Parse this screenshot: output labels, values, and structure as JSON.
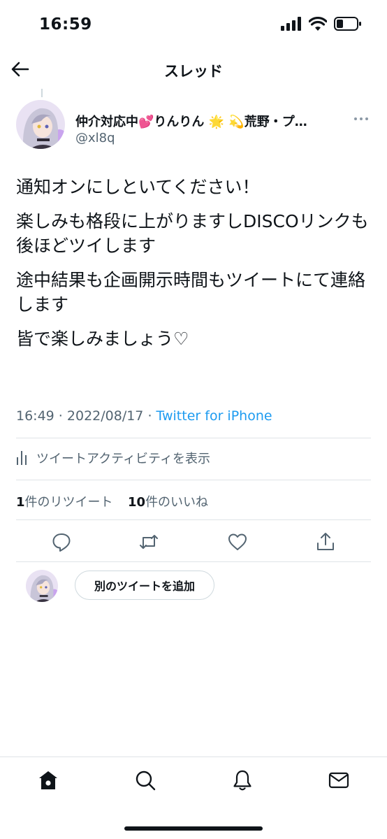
{
  "status_bar": {
    "time": "16:59"
  },
  "header": {
    "title": "スレッド"
  },
  "author": {
    "display_name": "仲介対応中💕りんりん 🌟 💫荒野・プ…",
    "handle": "@xl8q"
  },
  "tweet": {
    "lines": [
      "通知オンにしといてください！",
      "楽しみも格段に上がりますしDISCOリンクも後ほどツイします",
      "途中結果も企画開示時間もツイートにて連絡します",
      "皆で楽しみましょう♡"
    ],
    "time": "16:49",
    "date": "2022/08/17",
    "source": "Twitter for iPhone",
    "separator": " · "
  },
  "activity": {
    "label": "ツイートアクティビティを表示"
  },
  "stats": {
    "retweets_count": "1",
    "retweets_label": "件のリツイート",
    "likes_count": "10",
    "likes_label": "件のいいね"
  },
  "actions": [
    "reply-icon",
    "retweet-icon",
    "like-icon",
    "share-icon"
  ],
  "reply_area": {
    "add_button_label": "別のツイートを追加"
  },
  "tabs": [
    "home-icon",
    "search-icon",
    "notifications-icon",
    "messages-icon"
  ],
  "colors": {
    "link": "#1d9bf0",
    "secondary": "#536471",
    "text": "#0f1419"
  }
}
